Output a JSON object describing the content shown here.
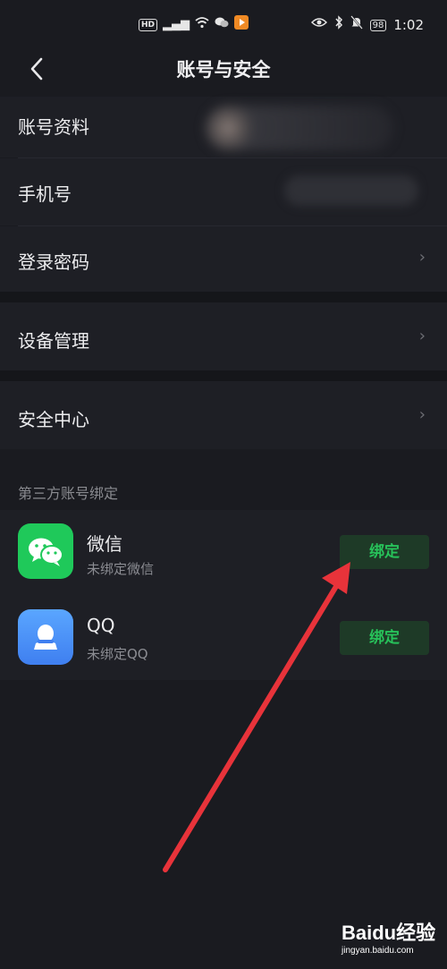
{
  "status_bar": {
    "left_icons": [
      "hd-icon",
      "4g-signal-icon",
      "wifi-icon",
      "wechat-notify-icon",
      "video-app-icon"
    ],
    "hd_label": "HD",
    "battery": "98",
    "time": "1:02"
  },
  "header": {
    "title": "账号与安全",
    "back_icon": "back-chevron-icon"
  },
  "settings": {
    "account_profile": "账号资料",
    "phone": "手机号",
    "login_password": "登录密码",
    "device_management": "设备管理",
    "security_center": "安全中心"
  },
  "third_party": {
    "section_title": "第三方账号绑定",
    "apps": [
      {
        "name": "微信",
        "status": "未绑定微信",
        "button": "绑定",
        "icon": "wechat-icon"
      },
      {
        "name": "QQ",
        "status": "未绑定QQ",
        "button": "绑定",
        "icon": "qq-icon"
      }
    ]
  },
  "colors": {
    "background": "#1a1b20",
    "row": "#1e1f25",
    "accent_green": "#27c25a",
    "arrow_red": "#e8333a"
  },
  "watermark": {
    "logo_text": "Baidu经验",
    "url": "jingyan.baidu.com"
  }
}
